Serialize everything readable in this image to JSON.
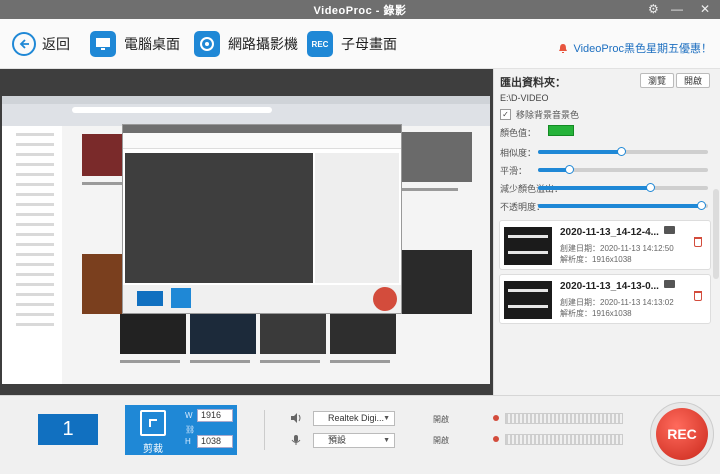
{
  "window": {
    "title": "VideoProc - 錄影"
  },
  "toolbar": {
    "back_label": "返回",
    "items": [
      {
        "label": "電腦桌面"
      },
      {
        "label": "網路攝影機"
      },
      {
        "label": "子母畫面"
      }
    ],
    "promo_text": "VideoProc黑色星期五優惠！"
  },
  "panel": {
    "heading": "匯出資料夾：",
    "browse_label": "瀏覽",
    "open_label": "開啟",
    "export_path": "E:\\D-VIDEO",
    "green_screen_label": "移除背景音景色",
    "settings": [
      {
        "label": "顏色值："
      },
      {
        "label": "相似度：",
        "value": 0.49
      },
      {
        "label": "平滑：",
        "value": 0.18
      },
      {
        "label": "減少顏色溢出：",
        "value": 0.66
      },
      {
        "label": "不透明度：",
        "value": 0.96
      }
    ],
    "key_color": "#26b33a",
    "recordings": [
      {
        "name": "2020-11-13_14-12-4...",
        "created": "創建日期：2020-11-13 14:12:50",
        "resolution": "解析度：1916x1038"
      },
      {
        "name": "2020-11-13_14-13-0...",
        "created": "創建日期：2020-11-13 14:13:02",
        "resolution": "解析度：1916x1038"
      }
    ]
  },
  "bottom": {
    "screen_number": "1",
    "crop_label": "剪裁",
    "width_label": "W",
    "height_label": "H",
    "width_value": "1916",
    "height_value": "1038",
    "audio_device": "Realtek Digi...",
    "mic_device": "預設",
    "level_label_1": "開啟",
    "level_label_2": "開啟",
    "rec_label": "REC"
  },
  "colors": {
    "accent": "#1f88d6",
    "rec": "#d34c3c"
  }
}
